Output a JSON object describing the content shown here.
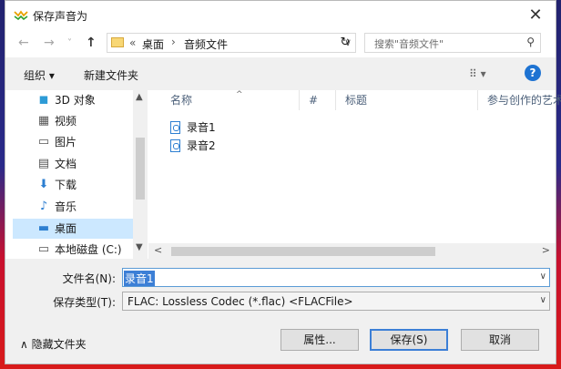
{
  "window": {
    "title": "保存声音为",
    "close_glyph": "✕"
  },
  "nav": {
    "back_glyph": "←",
    "forward_glyph": "→",
    "recent_glyph": "˅",
    "up_glyph": "↑",
    "address_overflow": "«",
    "breadcrumbs": [
      "桌面",
      "音频文件"
    ],
    "breadcrumb_sep": "›",
    "dropdown_glyph": "∨",
    "refresh_glyph": "↻",
    "search_placeholder": "搜索\"音频文件\"",
    "search_glyph": "⚲"
  },
  "toolbar": {
    "organize_label": "组织 ▾",
    "new_folder_label": "新建文件夹",
    "view_label": "⠿ ▾",
    "help_label": "?"
  },
  "sidebar": {
    "items": [
      {
        "label": "3D 对象",
        "icon": "cube-icon",
        "glyph": "◼",
        "color": "#2d9bd6"
      },
      {
        "label": "视频",
        "icon": "video-icon",
        "glyph": "▦",
        "color": "#555555"
      },
      {
        "label": "图片",
        "icon": "picture-icon",
        "glyph": "▭",
        "color": "#555555"
      },
      {
        "label": "文档",
        "icon": "document-icon",
        "glyph": "▤",
        "color": "#555555"
      },
      {
        "label": "下载",
        "icon": "download-icon",
        "glyph": "⬇",
        "color": "#2d7fd1"
      },
      {
        "label": "音乐",
        "icon": "music-icon",
        "glyph": "♪",
        "color": "#2d7fd1"
      },
      {
        "label": "桌面",
        "icon": "desktop-icon",
        "glyph": "▬",
        "color": "#2d7fd1",
        "selected": true
      },
      {
        "label": "本地磁盘 (C:)",
        "icon": "drive-icon",
        "glyph": "▭",
        "color": "#555555"
      }
    ],
    "scroll_up": "▲",
    "scroll_down": "▼"
  },
  "filelist": {
    "columns": [
      "名称",
      "#",
      "标题",
      "参与创作的艺术家"
    ],
    "sort_glyph": "^",
    "files": [
      {
        "name": "录音1",
        "icon": "audio-file-icon"
      },
      {
        "name": "录音2",
        "icon": "audio-file-icon"
      }
    ],
    "hscroll_left": "<",
    "hscroll_right": ">"
  },
  "form": {
    "filename_label": "文件名(N):",
    "filename_value": "录音1",
    "filetype_label": "保存类型(T):",
    "filetype_value": "FLAC: Lossless Codec (*.flac)   <FLACFile>",
    "dropdown_glyph": "∨"
  },
  "footer": {
    "hide_folders_label": "∧  隐藏文件夹",
    "properties_label": "属性...",
    "save_label": "保存(S)",
    "cancel_label": "取消"
  },
  "colors": {
    "accent": "#3c7fd6",
    "selection": "#cce8ff",
    "help": "#1e73d2"
  }
}
